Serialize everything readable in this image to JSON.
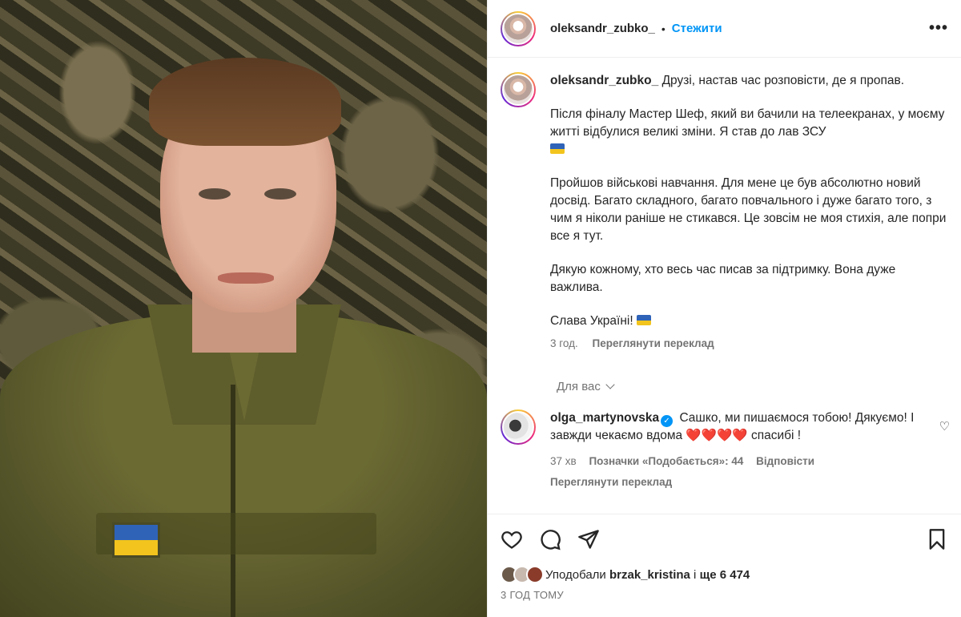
{
  "header": {
    "username": "oleksandr_zubko_",
    "separator": "•",
    "follow_label": "Стежити",
    "more_label": "•••"
  },
  "caption": {
    "username": "oleksandr_zubko_",
    "paragraphs": [
      "Друзі, настав час розповісти, де я пропав.",
      "Після фіналу Мастер Шеф, який ви бачили на телеекранах, у моєму житті відбулися великі зміни. Я став до лав ЗСУ",
      "Пройшов військові навчання. Для мене це був абсолютно новий досвід. Багато складного, багато повчального і дуже багато того, з чим я ніколи раніше не стикався. Це зовсім не моя стихія, але попри все я тут.",
      "Дякую кожному, хто весь час писав за підтримку. Вона дуже важлива.",
      "Слава Україні!"
    ],
    "time": "3 год.",
    "translate_label": "Переглянути переклад"
  },
  "for_you_label": "Для вас",
  "comment": {
    "username": "olga_martynovska",
    "verified": "✓",
    "text_part1": "Сашко, ми пишаємося тобою! Дякуємо! І завжди чекаємо вдома",
    "hearts": "❤️❤️❤️❤️",
    "text_part2": "спасибі !",
    "time": "37 хв",
    "likes_label": "Позначки «Подобається»: 44",
    "reply_label": "Відповісти",
    "translate_label": "Переглянути переклад",
    "like_icon": "♡"
  },
  "likes": {
    "prefix": "Уподобали",
    "user": "brzak_kristina",
    "middle": "і",
    "count": "ще 6 474"
  },
  "time_ago": "3 ГОД ТОМУ",
  "colors": {
    "follow": "#0095f6",
    "flag_blue": "#2f63b8",
    "flag_yellow": "#f2c41d"
  }
}
